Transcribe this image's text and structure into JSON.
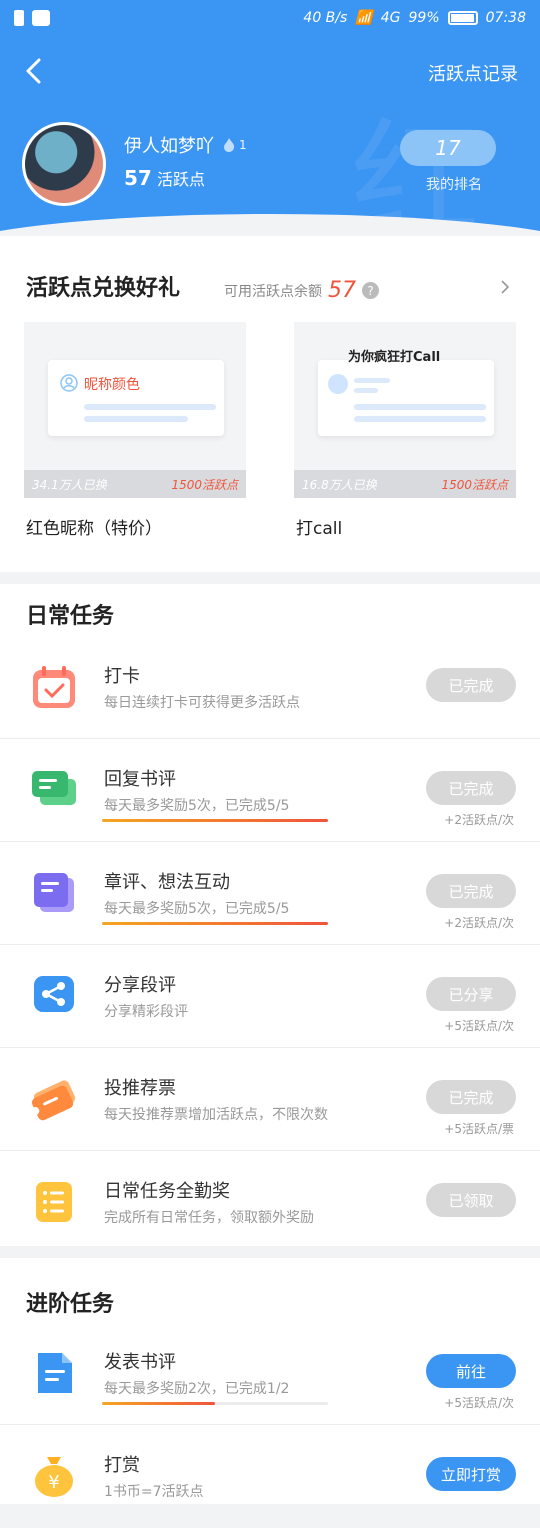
{
  "status_bar": {
    "speed": "40 B/s",
    "network": "4G",
    "battery": "99%",
    "time": "07:38"
  },
  "header": {
    "record_link": "活跃点记录"
  },
  "user": {
    "name": "伊人如梦吖",
    "level": "1",
    "points": "57",
    "points_label": "活跃点",
    "rank": "17",
    "rank_label": "我的排名"
  },
  "exchange": {
    "title": "活跃点兑换好礼",
    "balance_label": "可用活跃点余额",
    "balance": "57",
    "help": "?",
    "gifts": [
      {
        "preview_text": "昵称颜色",
        "sold": "34.1万人已换",
        "cost": "1500活跃点",
        "name": "红色昵称（特价）"
      },
      {
        "preview_text": "为你疯狂打Call",
        "sold": "16.8万人已换",
        "cost": "1500活跃点",
        "name": "打call"
      }
    ]
  },
  "daily": {
    "title": "日常任务",
    "tasks": [
      {
        "name": "打卡",
        "desc": "每日连续打卡可获得更多活跃点",
        "button": "已完成",
        "note": ""
      },
      {
        "name": "回复书评",
        "desc": "每天最多奖励5次，已完成5/5",
        "button": "已完成",
        "note": "+2活跃点/次",
        "progress": 1.0
      },
      {
        "name": "章评、想法互动",
        "desc": "每天最多奖励5次，已完成5/5",
        "button": "已完成",
        "note": "+2活跃点/次",
        "progress": 1.0
      },
      {
        "name": "分享段评",
        "desc": "分享精彩段评",
        "button": "已分享",
        "note": "+5活跃点/次"
      },
      {
        "name": "投推荐票",
        "desc": "每天投推荐票增加活跃点，不限次数",
        "button": "已完成",
        "note": "+5活跃点/票"
      },
      {
        "name": "日常任务全勤奖",
        "desc": "完成所有日常任务，领取额外奖励",
        "button": "已领取",
        "note": ""
      }
    ]
  },
  "advanced": {
    "title": "进阶任务",
    "tasks": [
      {
        "name": "发表书评",
        "desc": "每天最多奖励2次，已完成1/2",
        "button": "前往",
        "note": "+5活跃点/次",
        "progress": 0.5
      },
      {
        "name": "打赏",
        "desc": "1书币=7活跃点",
        "button": "立即打赏",
        "note": ""
      }
    ]
  },
  "colors": {
    "brand": "#3b95f2",
    "accent": "#f0543c",
    "done": "#d8d8d8"
  }
}
